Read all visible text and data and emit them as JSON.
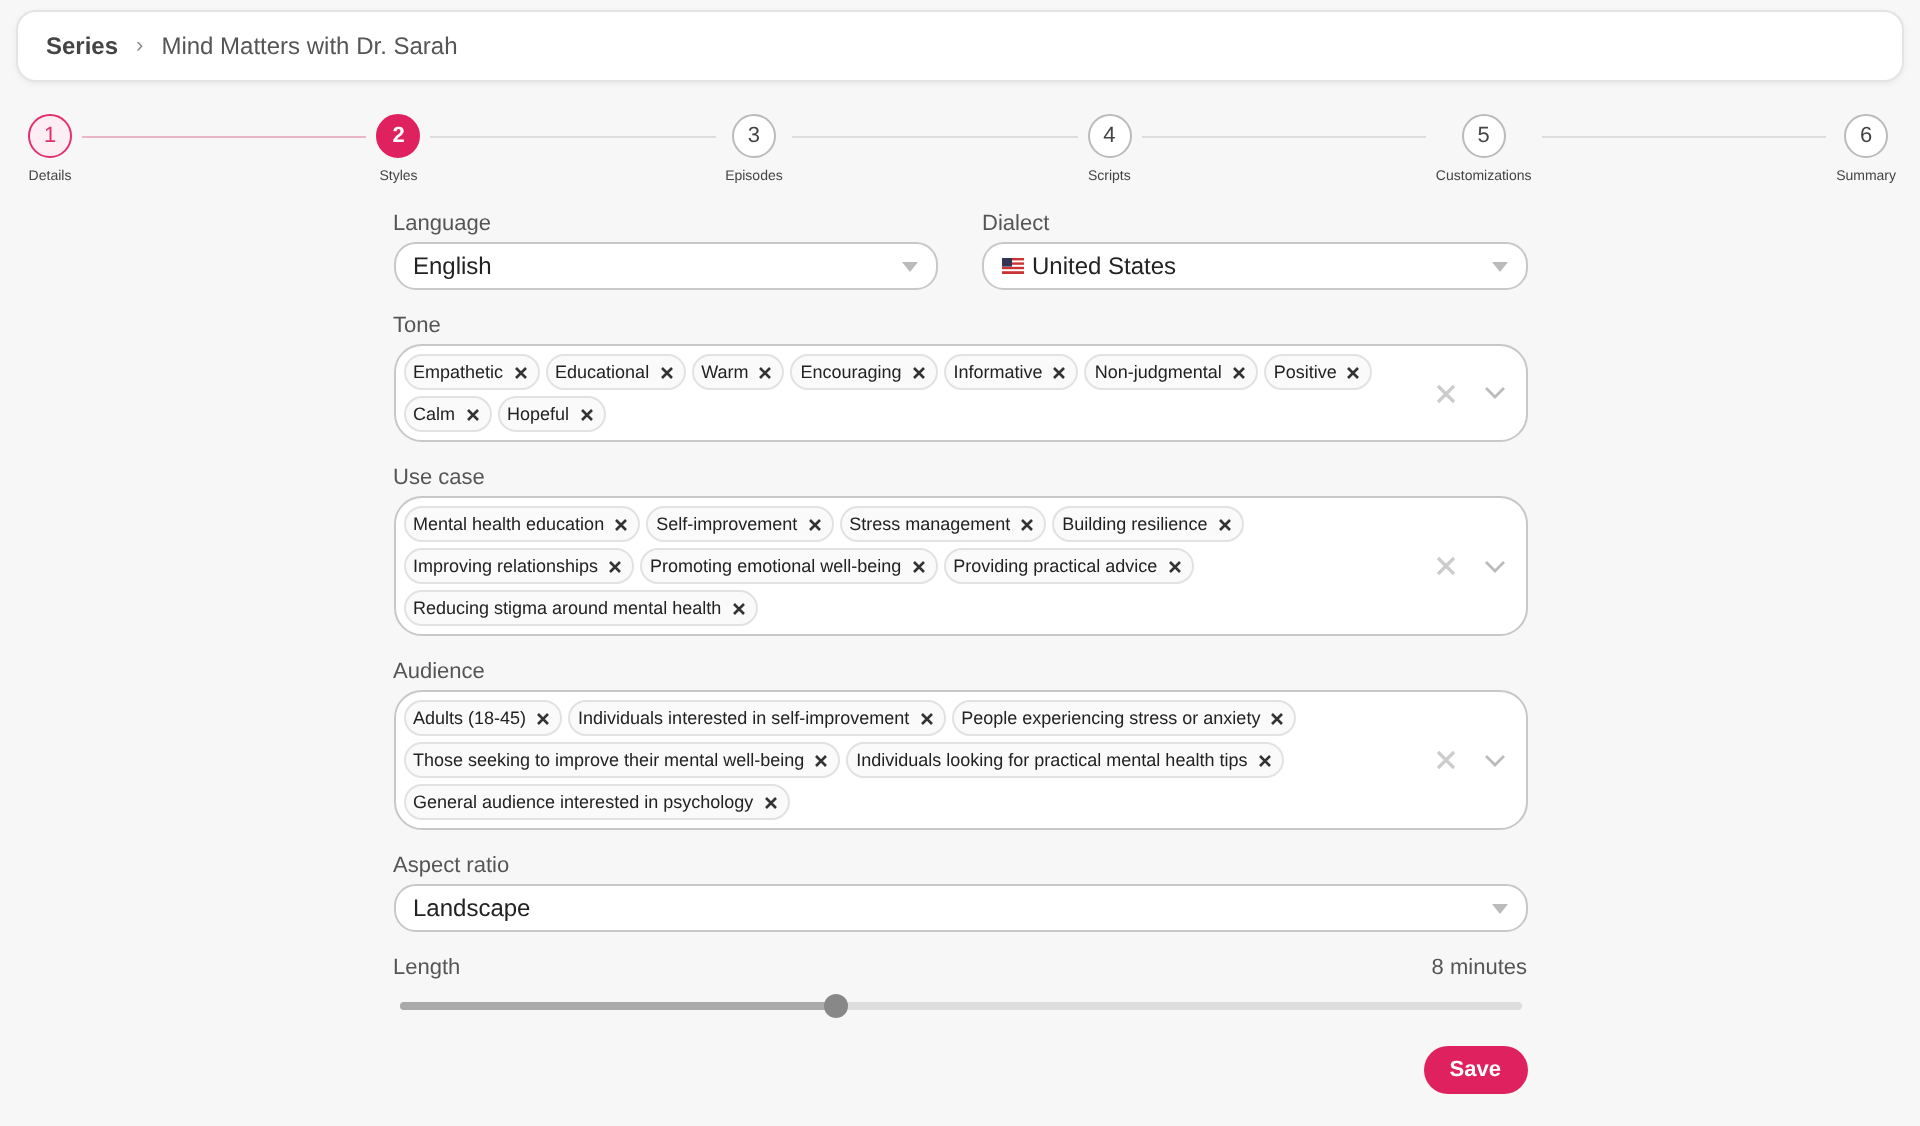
{
  "breadcrumb": {
    "root": "Series",
    "separator": "›",
    "current": "Mind Matters with Dr. Sarah"
  },
  "steps": [
    {
      "number": "1",
      "label": "Details",
      "completed": true,
      "selected": false
    },
    {
      "number": "2",
      "label": "Styles",
      "completed": false,
      "selected": true
    },
    {
      "number": "3",
      "label": "Episodes",
      "completed": false,
      "selected": false
    },
    {
      "number": "4",
      "label": "Scripts",
      "completed": false,
      "selected": false
    },
    {
      "number": "5",
      "label": "Customizations",
      "completed": false,
      "selected": false
    },
    {
      "number": "6",
      "label": "Summary",
      "completed": false,
      "selected": false
    }
  ],
  "language": {
    "label": "Language",
    "value": "English"
  },
  "dialect": {
    "label": "Dialect",
    "value": "United States"
  },
  "tone": {
    "label": "Tone",
    "tags": [
      "Empathetic",
      "Educational",
      "Warm",
      "Encouraging",
      "Informative",
      "Non-judgmental",
      "Positive",
      "Calm",
      "Hopeful"
    ]
  },
  "use_case": {
    "label": "Use case",
    "tags": [
      "Mental health education",
      "Self-improvement",
      "Stress management",
      "Building resilience",
      "Improving relationships",
      "Promoting emotional well-being",
      "Providing practical advice",
      "Reducing stigma around mental health"
    ]
  },
  "audience": {
    "label": "Audience",
    "tags": [
      "Adults (18-45)",
      "Individuals interested in self-improvement",
      "People experiencing stress or anxiety",
      "Those seeking to improve their mental well-being",
      "Individuals looking for practical mental health tips",
      "General audience interested in psychology"
    ]
  },
  "aspect_ratio": {
    "label": "Aspect ratio",
    "value": "Landscape"
  },
  "length": {
    "label": "Length",
    "reading": "8 minutes",
    "level": 0.39
  },
  "save_button": "Save"
}
